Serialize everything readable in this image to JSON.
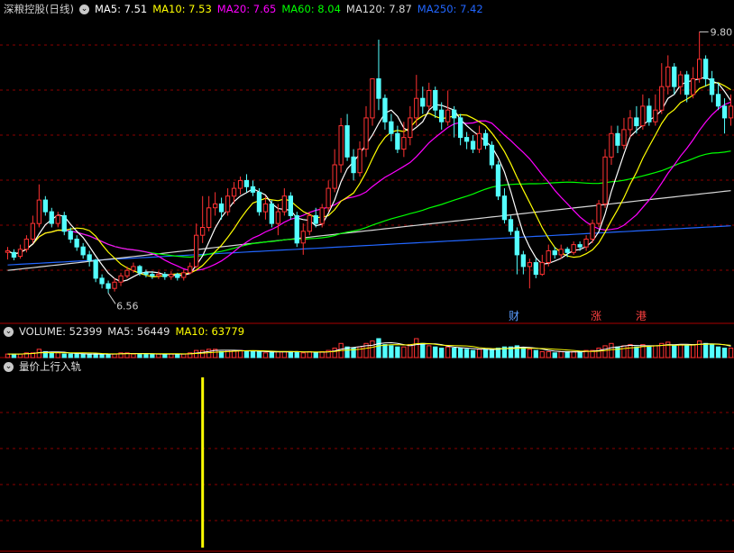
{
  "main_header": {
    "title": "深粮控股(日线)",
    "ma": [
      {
        "label": "MA5: 7.51",
        "color": "#ffffff"
      },
      {
        "label": "MA10: 7.53",
        "color": "#ffff00"
      },
      {
        "label": "MA20: 7.65",
        "color": "#ff00ff"
      },
      {
        "label": "MA60: 8.04",
        "color": "#00ff00"
      },
      {
        "label": "MA120: 7.87",
        "color": "#d8d8d8"
      },
      {
        "label": "MA250: 7.42",
        "color": "#2266ff"
      }
    ]
  },
  "vol_header": {
    "title": "VOLUME: 52399",
    "ma5": "MA5: 56449",
    "ma10": "MA10: 63779"
  },
  "ind_header": {
    "title": "量价上行入轨"
  },
  "markers": {
    "news1": "财",
    "news2": "涨",
    "news3": "港"
  },
  "colors": {
    "up": "#ff3232",
    "down": "#54ffff",
    "bg": "#000000",
    "grid": "#8b0000",
    "signal": "#ffff00"
  },
  "chart_data": {
    "type": "candlestick",
    "price_range": [
      6.3,
      10.1
    ],
    "high_label": "9.80",
    "low_label": "6.56",
    "candles": [
      [
        7.08,
        7.1,
        6.99,
        7.15
      ],
      [
        7.08,
        7.02,
        6.98,
        7.12
      ],
      [
        7.03,
        7.12,
        7.0,
        7.18
      ],
      [
        7.12,
        7.25,
        7.08,
        7.3
      ],
      [
        7.25,
        7.45,
        7.2,
        7.55
      ],
      [
        7.45,
        7.75,
        7.4,
        7.95
      ],
      [
        7.75,
        7.6,
        7.55,
        7.8
      ],
      [
        7.6,
        7.45,
        7.4,
        7.65
      ],
      [
        7.45,
        7.55,
        7.4,
        7.6
      ],
      [
        7.55,
        7.35,
        7.3,
        7.6
      ],
      [
        7.35,
        7.25,
        7.2,
        7.4
      ],
      [
        7.25,
        7.15,
        7.1,
        7.3
      ],
      [
        7.15,
        7.05,
        7.0,
        7.2
      ],
      [
        7.05,
        6.98,
        6.9,
        7.1
      ],
      [
        6.98,
        6.75,
        6.7,
        7.0
      ],
      [
        6.75,
        6.68,
        6.62,
        6.8
      ],
      [
        6.68,
        6.62,
        6.56,
        6.72
      ],
      [
        6.62,
        6.7,
        6.58,
        6.75
      ],
      [
        6.7,
        6.78,
        6.65,
        6.82
      ],
      [
        6.78,
        6.85,
        6.75,
        6.9
      ],
      [
        6.85,
        6.9,
        6.82,
        6.95
      ],
      [
        6.9,
        6.82,
        6.78,
        6.92
      ],
      [
        6.82,
        6.8,
        6.76,
        6.86
      ],
      [
        6.8,
        6.78,
        6.74,
        6.84
      ],
      [
        6.78,
        6.8,
        6.74,
        6.84
      ],
      [
        6.8,
        6.77,
        6.73,
        6.83
      ],
      [
        6.77,
        6.8,
        6.73,
        6.84
      ],
      [
        6.8,
        6.76,
        6.72,
        6.82
      ],
      [
        6.76,
        6.82,
        6.72,
        6.86
      ],
      [
        6.82,
        6.9,
        6.8,
        6.95
      ],
      [
        6.9,
        7.3,
        6.88,
        7.45
      ],
      [
        7.3,
        7.4,
        7.2,
        7.8
      ],
      [
        7.4,
        7.65,
        7.35,
        7.8
      ],
      [
        7.65,
        7.7,
        7.55,
        7.85
      ],
      [
        7.7,
        7.6,
        7.5,
        7.78
      ],
      [
        7.6,
        7.8,
        7.55,
        7.9
      ],
      [
        7.8,
        7.9,
        7.7,
        7.98
      ],
      [
        7.9,
        8.0,
        7.82,
        8.05
      ],
      [
        8.0,
        7.92,
        7.85,
        8.08
      ],
      [
        7.92,
        7.85,
        7.8,
        8.0
      ],
      [
        7.85,
        7.6,
        7.55,
        7.9
      ],
      [
        7.6,
        7.7,
        7.5,
        7.8
      ],
      [
        7.7,
        7.45,
        7.4,
        7.75
      ],
      [
        7.45,
        7.6,
        7.3,
        7.7
      ],
      [
        7.6,
        7.8,
        7.55,
        7.9
      ],
      [
        7.8,
        7.55,
        7.5,
        7.85
      ],
      [
        7.55,
        7.2,
        7.15,
        7.6
      ],
      [
        7.2,
        7.35,
        7.05,
        7.45
      ],
      [
        7.35,
        7.55,
        7.3,
        7.6
      ],
      [
        7.55,
        7.45,
        7.4,
        7.65
      ],
      [
        7.45,
        7.65,
        7.4,
        7.7
      ],
      [
        7.65,
        7.9,
        7.6,
        8.0
      ],
      [
        7.9,
        8.2,
        7.85,
        8.4
      ],
      [
        8.2,
        8.7,
        8.1,
        8.8
      ],
      [
        8.7,
        8.3,
        8.25,
        8.85
      ],
      [
        8.3,
        8.1,
        8.0,
        8.4
      ],
      [
        8.1,
        8.4,
        8.05,
        8.5
      ],
      [
        8.4,
        8.8,
        8.3,
        8.95
      ],
      [
        8.8,
        9.3,
        8.7,
        9.3
      ],
      [
        9.3,
        9.05,
        8.9,
        9.8
      ],
      [
        9.05,
        8.75,
        8.65,
        9.1
      ],
      [
        8.75,
        8.6,
        8.5,
        8.85
      ],
      [
        8.6,
        8.4,
        8.35,
        8.7
      ],
      [
        8.4,
        8.55,
        8.3,
        8.75
      ],
      [
        8.55,
        8.8,
        8.45,
        8.95
      ],
      [
        8.8,
        9.05,
        8.7,
        9.35
      ],
      [
        9.05,
        8.95,
        8.85,
        9.2
      ],
      [
        8.95,
        9.15,
        8.9,
        9.25
      ],
      [
        9.15,
        8.9,
        8.8,
        9.2
      ],
      [
        8.9,
        8.75,
        8.65,
        9.0
      ],
      [
        8.75,
        8.9,
        8.7,
        9.15
      ],
      [
        8.9,
        8.8,
        8.55,
        8.95
      ],
      [
        8.8,
        8.55,
        8.45,
        8.85
      ],
      [
        8.55,
        8.5,
        8.4,
        8.62
      ],
      [
        8.5,
        8.4,
        8.35,
        8.58
      ],
      [
        8.4,
        8.6,
        8.35,
        8.7
      ],
      [
        8.6,
        8.45,
        8.4,
        8.65
      ],
      [
        8.45,
        8.2,
        8.15,
        8.5
      ],
      [
        8.2,
        7.8,
        7.75,
        8.25
      ],
      [
        7.8,
        7.5,
        7.45,
        7.9
      ],
      [
        7.5,
        7.35,
        7.3,
        7.55
      ],
      [
        7.35,
        7.05,
        6.8,
        7.4
      ],
      [
        7.05,
        6.9,
        6.8,
        7.1
      ],
      [
        6.9,
        6.95,
        6.62,
        7.0
      ],
      [
        6.95,
        6.8,
        6.75,
        7.0
      ],
      [
        6.8,
        6.95,
        6.78,
        7.05
      ],
      [
        6.95,
        7.1,
        6.9,
        7.18
      ],
      [
        7.1,
        7.05,
        7.0,
        7.15
      ],
      [
        7.05,
        7.12,
        7.0,
        7.18
      ],
      [
        7.12,
        7.08,
        7.02,
        7.15
      ],
      [
        7.08,
        7.18,
        7.05,
        7.22
      ],
      [
        7.18,
        7.15,
        7.1,
        7.22
      ],
      [
        7.15,
        7.25,
        7.1,
        7.3
      ],
      [
        7.25,
        7.45,
        7.2,
        7.5
      ],
      [
        7.45,
        7.7,
        7.4,
        7.75
      ],
      [
        7.7,
        8.3,
        7.65,
        8.4
      ],
      [
        8.3,
        8.6,
        8.2,
        8.7
      ],
      [
        8.6,
        8.45,
        8.35,
        8.7
      ],
      [
        8.45,
        8.65,
        8.4,
        8.8
      ],
      [
        8.65,
        8.8,
        8.55,
        8.9
      ],
      [
        8.8,
        8.7,
        8.6,
        8.95
      ],
      [
        8.7,
        8.95,
        8.65,
        9.1
      ],
      [
        8.95,
        8.75,
        8.7,
        9.05
      ],
      [
        8.75,
        8.9,
        8.7,
        9.1
      ],
      [
        8.9,
        9.2,
        8.85,
        9.5
      ],
      [
        9.2,
        9.45,
        9.1,
        9.6
      ],
      [
        9.45,
        9.2,
        9.1,
        9.5
      ],
      [
        9.2,
        9.35,
        9.1,
        9.4
      ],
      [
        9.35,
        9.1,
        9.0,
        9.4
      ],
      [
        9.1,
        9.3,
        9.05,
        9.45
      ],
      [
        9.3,
        9.55,
        9.25,
        9.9
      ],
      [
        9.55,
        9.3,
        9.2,
        9.6
      ],
      [
        9.3,
        9.1,
        9.0,
        9.4
      ],
      [
        9.1,
        8.95,
        8.9,
        9.25
      ],
      [
        8.95,
        8.8,
        8.6,
        9.05
      ],
      [
        8.8,
        8.95,
        8.7,
        9.1
      ]
    ],
    "volumes": [
      3,
      3,
      3,
      4,
      4,
      7,
      5,
      4,
      4,
      3,
      3,
      3,
      3,
      3,
      3,
      3,
      3,
      3,
      4,
      4,
      3,
      3,
      3,
      3,
      3,
      3,
      3,
      3,
      3,
      4,
      6,
      6,
      7,
      7,
      5,
      6,
      6,
      6,
      5,
      5,
      5,
      4,
      5,
      5,
      5,
      5,
      5,
      4,
      5,
      4,
      5,
      6,
      8,
      12,
      9,
      8,
      9,
      12,
      14,
      16,
      11,
      10,
      9,
      9,
      11,
      16,
      12,
      10,
      9,
      8,
      9,
      8,
      8,
      7,
      6,
      7,
      7,
      7,
      8,
      9,
      9,
      10,
      8,
      7,
      6,
      5,
      5,
      4,
      5,
      5,
      5,
      5,
      6,
      6,
      8,
      10,
      12,
      9,
      10,
      11,
      9,
      11,
      9,
      10,
      12,
      13,
      10,
      11,
      10,
      11,
      14,
      12,
      11,
      9,
      8,
      8
    ],
    "indicator": {
      "name": "量价上行入轨",
      "signal_index": 31
    }
  }
}
